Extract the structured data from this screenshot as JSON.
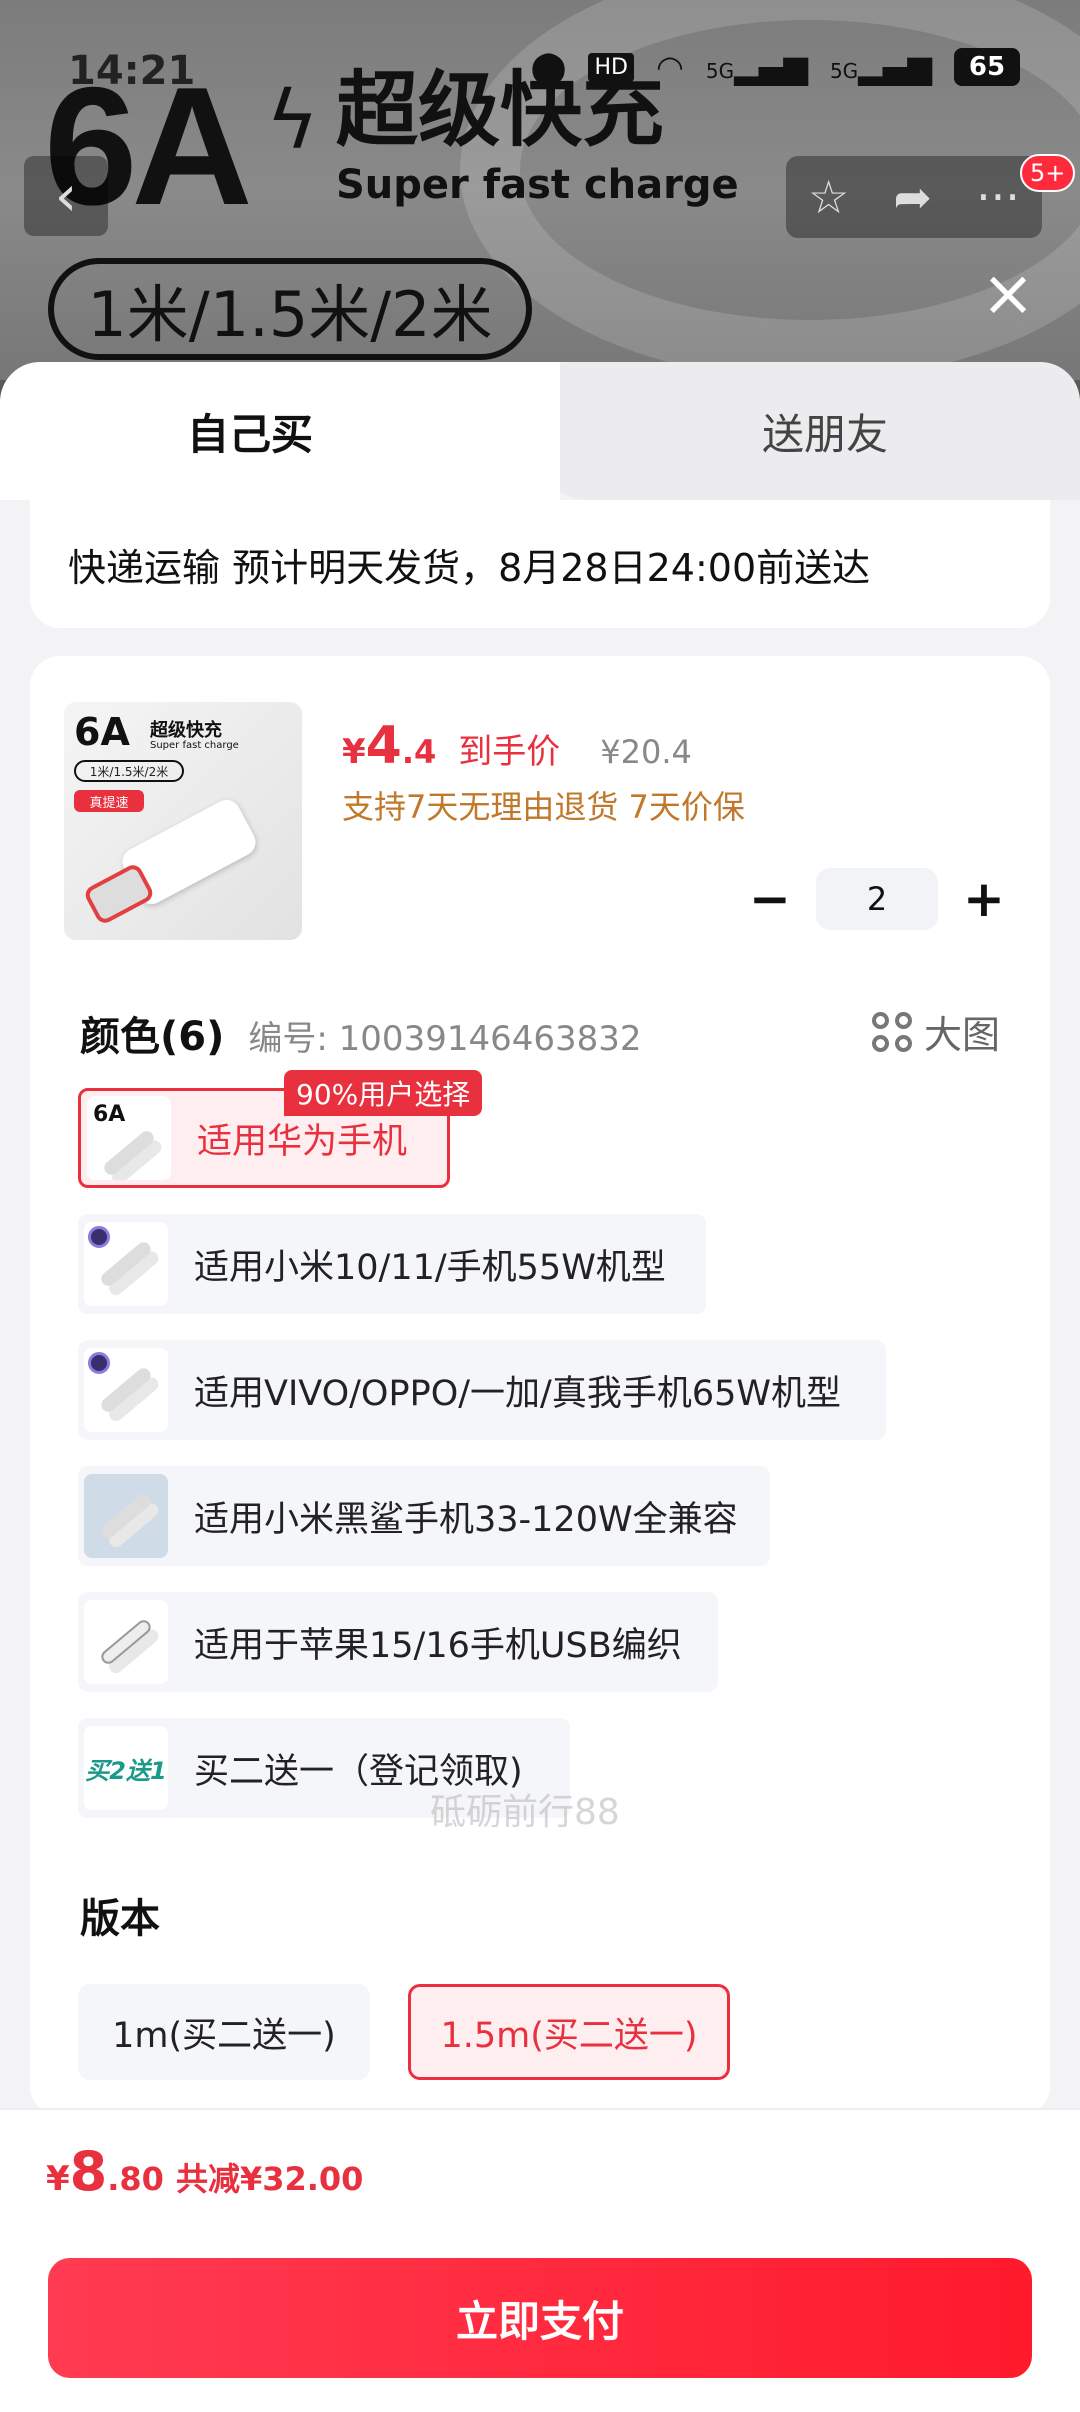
{
  "status_bar": {
    "time": "14:21",
    "hd": "HD",
    "signal_1": "5G",
    "signal_2": "5G",
    "battery": "65"
  },
  "banner": {
    "big_text": "6A",
    "cn_title": "超级快充",
    "en_title": "Super fast charge",
    "length_pill": "1米/1.5米/2米"
  },
  "nav": {
    "badge": "5+"
  },
  "tabs": {
    "self": "自己买",
    "friend": "送朋友"
  },
  "delivery": {
    "text": "快递运输 预计明天发货，8月28日24:00前送达"
  },
  "product": {
    "thumb": {
      "big": "6A",
      "cn": "超级快充",
      "en": "Super fast charge",
      "pill": "1米/1.5米/2米",
      "tag": "真提速"
    },
    "price_symbol": "¥",
    "price_int": "4",
    "price_dec": ".4",
    "price_label": "到手价",
    "original_price": "¥20.4",
    "guarantee": "支持7天无理由退货 7天价保",
    "quantity": "2"
  },
  "color_section": {
    "title": "颜色(6)",
    "code": "编号: 10039146463832",
    "big_image_label": "大图",
    "popular_badge": "90%用户选择",
    "options": [
      {
        "label": "适用华为手机",
        "icon": "6A"
      },
      {
        "label": "适用小米10/11/手机55W机型"
      },
      {
        "label": "适用VIVO/OPPO/一加/真我手机65W机型"
      },
      {
        "label": "适用小米黑鲨手机33-120W全兼容"
      },
      {
        "label": "适用于苹果15/16手机USB编织"
      },
      {
        "label": "买二送一（登记领取)",
        "icon": "买2送1"
      }
    ]
  },
  "version_section": {
    "title": "版本",
    "options": [
      {
        "label": "1m(买二送一)"
      },
      {
        "label": "1.5m(买二送一)"
      }
    ]
  },
  "watermark": "砥砺前行88",
  "footer": {
    "symbol": "¥",
    "total_int": "8",
    "total_dec": ".80",
    "saved": "共减¥32.00",
    "pay_label": "立即支付"
  },
  "colors": {
    "accent": "#e8303e",
    "guarantee": "#c0782a",
    "pay_start": "#ff3b52",
    "pay_end": "#ff1a2c"
  }
}
